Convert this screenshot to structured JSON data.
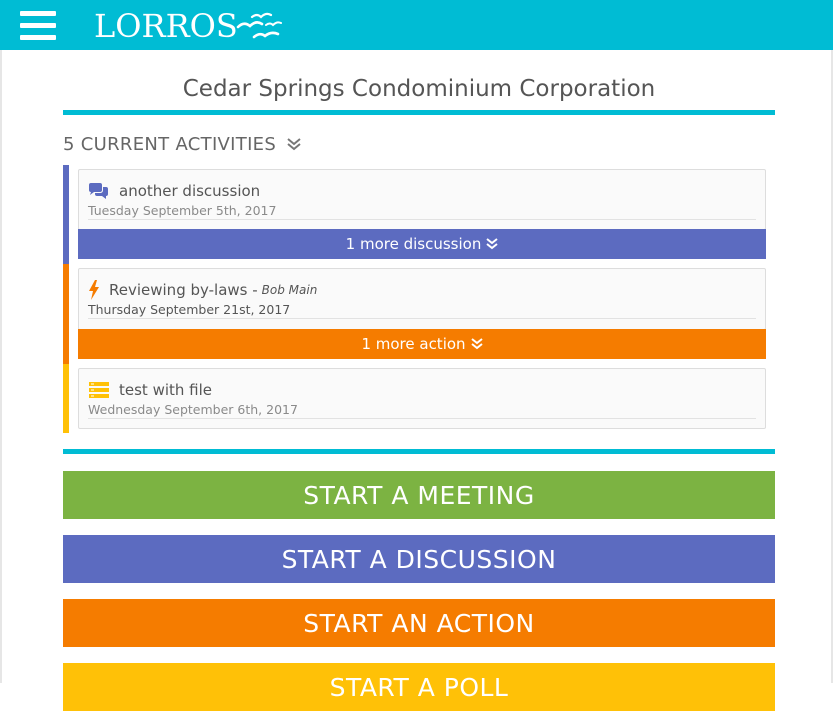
{
  "app": {
    "logo_text": "LORROS",
    "brand_color": "#00bcd4"
  },
  "header": {
    "menu_icon": "hamburger-menu-icon"
  },
  "organization": {
    "title": "Cedar Springs Condominium Corporation"
  },
  "activities": {
    "header_label": "5 CURRENT ACTIVITIES",
    "toggle_icon": "double-chevron-down-icon",
    "groups": [
      {
        "kind": "discussion",
        "color": "#5c6bc0",
        "icon": "comments-icon",
        "title": "another discussion",
        "author": "",
        "date": "Tuesday September 5th, 2017",
        "more_label": "1 more discussion"
      },
      {
        "kind": "action",
        "color": "#f57c00",
        "icon": "lightning-bolt-icon",
        "title": "Reviewing by-laws -",
        "author": "Bob Main",
        "date": "Thursday September 21st, 2017",
        "more_label": "1 more action"
      },
      {
        "kind": "poll",
        "color": "#ffc107",
        "icon": "poll-icon",
        "title": "test with file",
        "author": "",
        "date": "Wednesday September 6th, 2017",
        "more_label": ""
      }
    ]
  },
  "actions": {
    "start_meeting": {
      "label": "START A MEETING",
      "color": "#7cb342"
    },
    "start_discussion": {
      "label": "START A DISCUSSION",
      "color": "#5c6bc0"
    },
    "start_action": {
      "label": "START AN ACTION",
      "color": "#f57c00"
    },
    "start_poll": {
      "label": "START A POLL",
      "color": "#ffc107"
    }
  }
}
